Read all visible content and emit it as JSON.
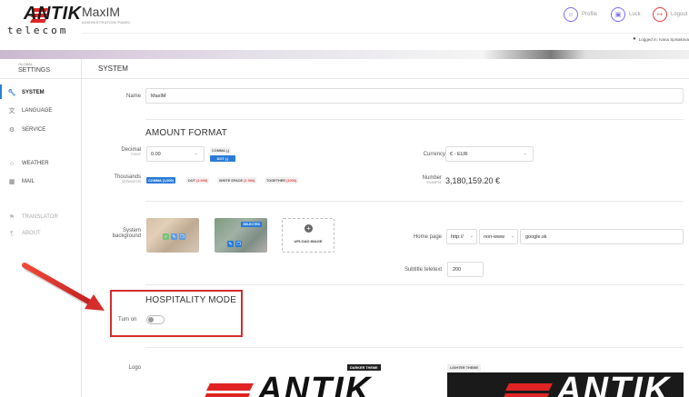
{
  "header": {
    "logo_word": "ANTIK",
    "logo_sub": "telecom",
    "app_title": "MaxIM",
    "app_subtitle": "ADMINISTRATION PANEL",
    "profile_label": "Profile",
    "lock_label": "Lock",
    "logout_label": "Logout",
    "logged_in": "Logged in: Ivana Spisakova"
  },
  "sidebar": {
    "head_small": "GLOBAL",
    "head_big": "SETTINGS",
    "items": [
      {
        "label": "SYSTEM",
        "icon": "wrench-icon"
      },
      {
        "label": "LANGUAGE",
        "icon": "translate-icon"
      },
      {
        "label": "SERVICE",
        "icon": "gears-icon"
      },
      {
        "label": "WEATHER",
        "icon": "circle-icon"
      },
      {
        "label": "MAIL",
        "icon": "grid-icon"
      },
      {
        "label": "TRANSLATOR",
        "icon": "flag-icon"
      },
      {
        "label": "ABOUT",
        "icon": "paragraph-icon"
      }
    ]
  },
  "main": {
    "title": "SYSTEM",
    "name_label": "Name",
    "name_value": "MaxIM",
    "amount_format_title": "AMOUNT FORMAT",
    "decimal_label": "Decimal",
    "decimal_sub": "POINT",
    "decimal_value": "0.00",
    "decimal_tags": [
      "COMMA (,)",
      "DOT (.)"
    ],
    "currency_label": "Currency",
    "currency_value": "€ - EUR",
    "thousands_label": "Thousands",
    "thousands_sub": "SEPARATOR",
    "thousands_tags": [
      {
        "text": "COMMA",
        "example": "(1,000)"
      },
      {
        "text": "DOT",
        "example": "(1.000)"
      },
      {
        "text": "WHITE SPACE",
        "example": "(1 000)"
      },
      {
        "text": "TOGETHER",
        "example": "(1000)"
      }
    ],
    "number_label": "Number",
    "number_sub": "EXAMPLE",
    "number_example": "3,180,159.20 €",
    "background_label_1": "System",
    "background_label_2": "background",
    "selected_badge": "SELECTED",
    "upload_label": "UPLOAD IMAGE",
    "homepage_label": "Home page",
    "homepage_protocol": "http://",
    "homepage_www": "non-www",
    "homepage_value": "google.sk",
    "teletext_label": "Subtitle teletext",
    "teletext_value": "200",
    "hospitality_title": "HOSPITALITY MODE",
    "turn_on_label": "Turn on",
    "logo_label": "Logo",
    "darker_theme": "DARKER THEME",
    "lighter_theme": "LIGHTER THEME",
    "preview_word": "ANTIK"
  },
  "colors": {
    "accent": "#2a7bd8",
    "highlight": "#d62c2c",
    "brand_red": "#e02424"
  }
}
